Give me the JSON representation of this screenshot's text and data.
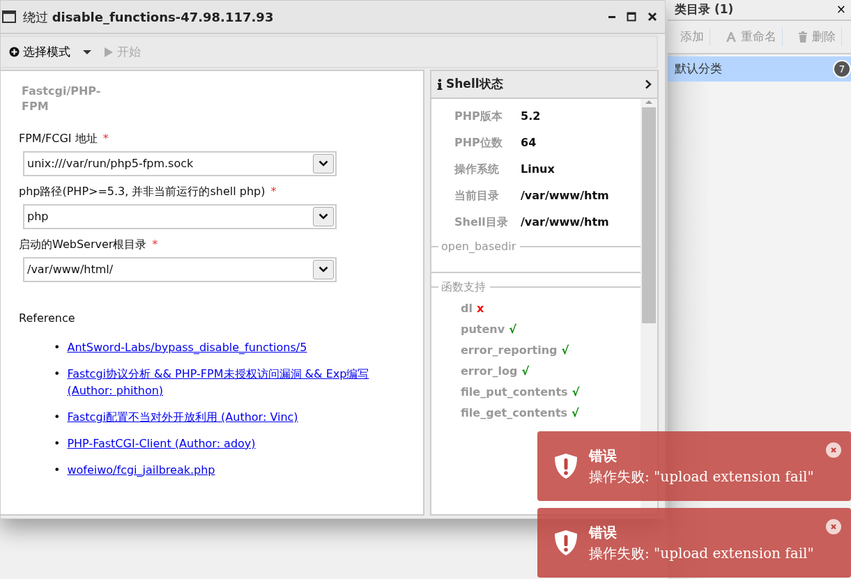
{
  "background_window": {
    "title": "类目录 (1)",
    "close": "×",
    "toolbar": [
      {
        "kind": "add",
        "label": "添加"
      },
      {
        "kind": "rename",
        "label": "重命名"
      },
      {
        "kind": "delete",
        "label": "删除"
      }
    ],
    "categories": [
      {
        "label": "默认分类",
        "count": "7",
        "selected": true
      }
    ]
  },
  "window": {
    "title_prefix": "绕过",
    "title": "disable_functions-47.98.117.93",
    "controls": [
      {
        "kind": "minimize"
      },
      {
        "kind": "maximize"
      },
      {
        "kind": "close"
      }
    ]
  },
  "toolbar": {
    "mode_button": {
      "label": "选择模式"
    },
    "start_button": {
      "label": "开始",
      "disabled": true
    }
  },
  "form": {
    "heading": "Fastcgi/PHP-FPM",
    "fields": [
      {
        "label": "FPM/FCGI 地址",
        "required_mark": "*",
        "value": "unix:///var/run/php5-fpm.sock"
      },
      {
        "label": "php路径(PHP>=5.3, 并非当前运行的shell php)",
        "required_mark": "*",
        "value": "php"
      },
      {
        "label": "启动的WebServer根目录",
        "required_mark": "*",
        "value": "/var/www/html/"
      }
    ],
    "reference_heading": "Reference",
    "references": [
      {
        "bullet": "•",
        "text": "AntSword-Labs/bypass_disable_functions/5"
      },
      {
        "bullet": "•",
        "text": "Fastcgi协议分析 && PHP-FPM未授权访问漏洞 && Exp编写 (Author: phithon)"
      },
      {
        "bullet": "•",
        "text": "Fastcgi配置不当对外开放利用 (Author: Vinc)"
      },
      {
        "bullet": "•",
        "text": "PHP-FastCGI-Client (Author: adoy)"
      },
      {
        "bullet": "•",
        "text": "wofeiwo/fcgi_jailbreak.php"
      }
    ]
  },
  "shell_status": {
    "title": "Shell状态",
    "info": [
      {
        "label": "PHP版本",
        "value": "5.2"
      },
      {
        "label": "PHP位数",
        "value": "64"
      },
      {
        "label": "操作系统",
        "value": "Linux"
      },
      {
        "label": "当前目录",
        "value": "/var/www/htm"
      },
      {
        "label": "Shell目录",
        "value": "/var/www/htm"
      }
    ],
    "open_basedir_legend": "open_basedir",
    "functions_legend": "函数支持",
    "functions": [
      {
        "name": "dl",
        "supported": false,
        "mark": "x"
      },
      {
        "name": "putenv",
        "supported": true,
        "mark": "√"
      },
      {
        "name": "error_reporting",
        "supported": true,
        "mark": "√"
      },
      {
        "name": "error_log",
        "supported": true,
        "mark": "√"
      },
      {
        "name": "file_put_contents",
        "supported": true,
        "mark": "√"
      },
      {
        "name": "file_get_contents",
        "supported": true,
        "mark": "√"
      }
    ]
  },
  "toasts": [
    {
      "title": "错误",
      "message": "操作失败: \"upload extension fail\""
    },
    {
      "title": "错误",
      "message": "操作失败: \"upload extension fail\""
    }
  ]
}
